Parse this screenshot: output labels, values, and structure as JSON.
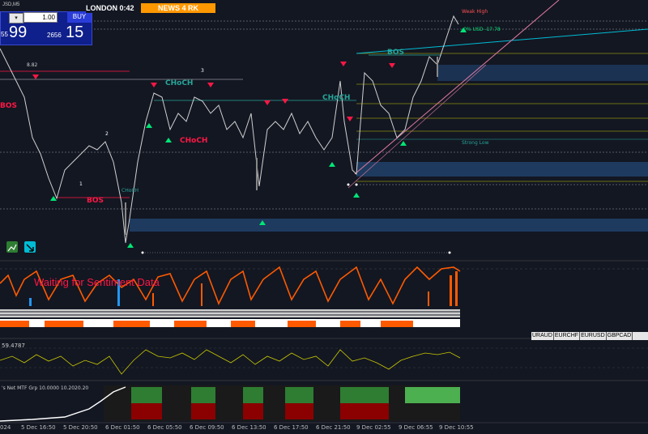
{
  "trade_panel": {
    "symbol_fragment": "JSD,M5",
    "lot_value": "1.00",
    "dropdown_glyph": "▾",
    "buy_label": "BUY",
    "bid_left": "55",
    "bid_big": "99",
    "ask_left": "2656",
    "ask_big": "15"
  },
  "session": {
    "london_label": "LONDON 0:42",
    "news_label": "NEWS 4 RK"
  },
  "annotations": {
    "weak_high": "Weak High",
    "pct_usd": "-0% USD -17.78",
    "strong_low": "Strong Low",
    "bos_top": "BOS",
    "choch_teal_1": "CHoCH",
    "choch_teal_2": "CHoCH",
    "bos_red_lower": "BOS",
    "choch_red": "CHoCH",
    "bos_left": "BOS",
    "choch_left_low": "CHoCH",
    "level_label": "8.82",
    "num_1": "1",
    "num_2": "2",
    "num_3": "3",
    "sentiment_msg": "Waiting for Sentiment Data"
  },
  "oscillator": {
    "value_label": "59.4787"
  },
  "mtf": {
    "label": "'s Net MTF Grp 10.0000 10.2020.20"
  },
  "symbol_tabs": [
    "URAUD",
    "EURCHF",
    "EURUSD",
    "GBPCAD",
    ""
  ],
  "x_axis": [
    "024",
    "5 Dec 16:50",
    "5 Dec 20:50",
    "6 Dec 01:50",
    "6 Dec 05:50",
    "6 Dec 09:50",
    "6 Dec 13:50",
    "6 Dec 17:50",
    "6 Dec 21:50",
    "9 Dec 02:55",
    "9 Dec 06:55",
    "9 Dec 10:55"
  ],
  "colors": {
    "background": "#131722",
    "bull_arrow": "#00e676",
    "bear_arrow": "#ff1744",
    "teal": "#26a69a",
    "zone": "#1e3a5f",
    "orange": "#ff5a00",
    "olive": "#c8c800",
    "cyan_line": "#00bcd4",
    "pink_line": "#e07aa0"
  },
  "icons": [
    "chart-tool-icon",
    "draw-tool-icon"
  ]
}
